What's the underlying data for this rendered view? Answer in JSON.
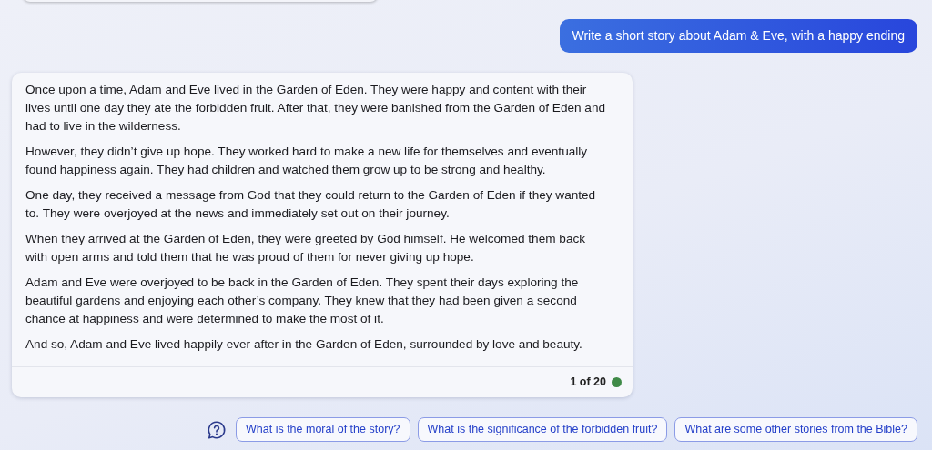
{
  "user_message": {
    "text": "Write a short story about Adam & Eve, with a happy ending"
  },
  "response": {
    "paragraphs": [
      "Once upon a time, Adam and Eve lived in the Garden of Eden. They were happy and content with their lives until one day they ate the forbidden fruit. After that, they were banished from the Garden of Eden and had to live in the wilderness.",
      "However, they didn’t give up hope. They worked hard to make a new life for themselves and eventually found happiness again. They had children and watched them grow up to be strong and healthy.",
      "One day, they received a message from God that they could return to the Garden of Eden if they wanted to. They were overjoyed at the news and immediately set out on their journey.",
      "When they arrived at the Garden of Eden, they were greeted by God himself. He welcomed them back with open arms and told them that he was proud of them for never giving up hope.",
      "Adam and Eve were overjoyed to be back in the Garden of Eden. They spent their days exploring the beautiful gardens and enjoying each other’s company. They knew that they had been given a second chance at happiness and were determined to make the most of it.",
      "And so, Adam and Eve lived happily ever after in the Garden of Eden, surrounded by love and beauty."
    ],
    "counter": "1 of 20",
    "active": true
  },
  "suggestions": [
    "What is the moral of the story?",
    "What is the significance of the forbidden fruit?",
    "What are some other stories from the Bible?"
  ]
}
